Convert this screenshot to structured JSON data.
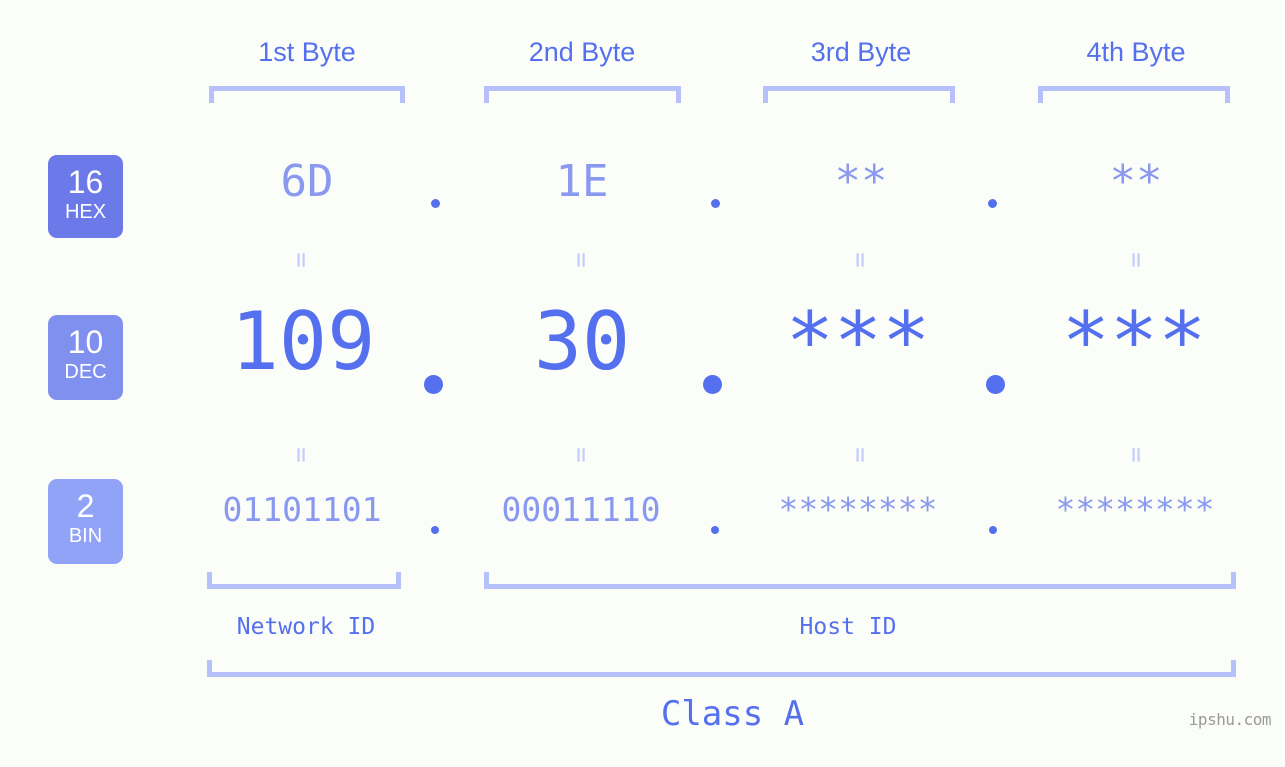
{
  "headers": [
    {
      "label": "1st Byte"
    },
    {
      "label": "2nd Byte"
    },
    {
      "label": "3rd Byte"
    },
    {
      "label": "4th Byte"
    }
  ],
  "bases": [
    {
      "number": "16",
      "abbr": "HEX",
      "color": "#6b7ae8"
    },
    {
      "number": "10",
      "abbr": "DEC",
      "color": "#8090ef"
    },
    {
      "number": "2",
      "abbr": "BIN",
      "color": "#90a3f7"
    }
  ],
  "rows": {
    "hex": {
      "values": [
        "6D",
        "1E",
        "**",
        "**"
      ]
    },
    "dec": {
      "values": [
        "109",
        "30",
        "***",
        "***"
      ]
    },
    "bin": {
      "values": [
        "01101101",
        "00011110",
        "********",
        "********"
      ]
    }
  },
  "separators": {
    "glyph": "."
  },
  "equals": {
    "glyph": "="
  },
  "segments": [
    {
      "label": "Network ID"
    },
    {
      "label": "Host ID"
    }
  ],
  "class": {
    "label": "Class A"
  },
  "watermark": {
    "text": "ipshu.com"
  },
  "colors": {
    "background": "#fbfdf8",
    "accent": "#5570ef",
    "accent_light": "#8a99f0",
    "bracket": "#b6c1fb"
  }
}
